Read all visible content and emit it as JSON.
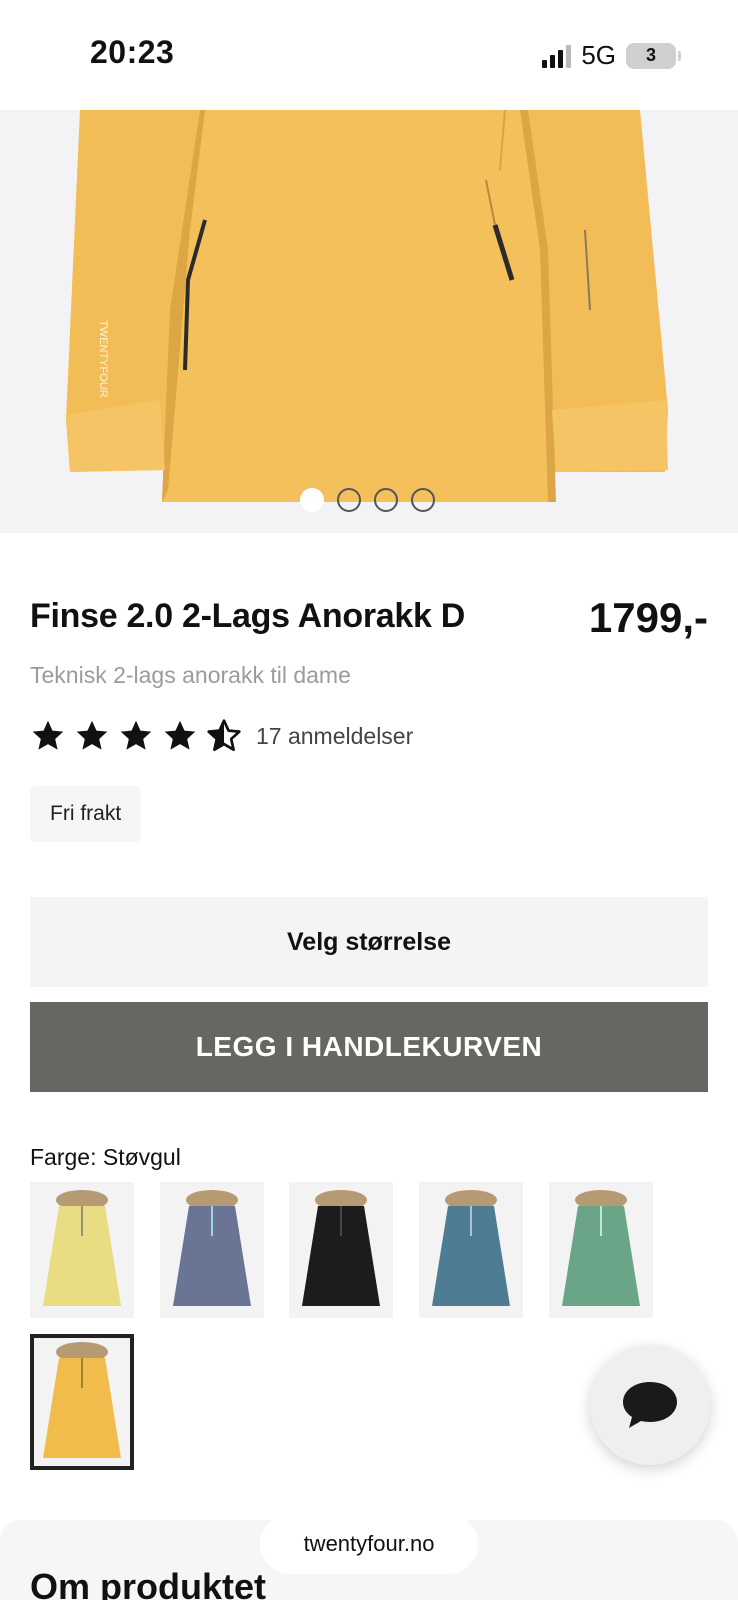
{
  "status_bar": {
    "time": "20:23",
    "network": "5G",
    "battery": "3"
  },
  "product": {
    "title": "Finse 2.0 2-Lags Anorakk D",
    "price": "1799,-",
    "subtitle": "Teknisk 2-lags anorakk til dame",
    "rating": 4.5,
    "reviews": "17 anmeldelser",
    "badge": "Fri frakt"
  },
  "gallery": {
    "image_count": 4,
    "active_index": 0
  },
  "actions": {
    "size_label": "Velg størrelse",
    "cart_label": "LEGG I HANDLEKURVEN"
  },
  "colors": {
    "label": "Farge: Støvgul",
    "swatches": [
      {
        "color": "#e8dd82"
      },
      {
        "color": "#6a7596"
      },
      {
        "color": "#1c1c1c"
      },
      {
        "color": "#4d7c93"
      },
      {
        "color": "#6aa587"
      },
      {
        "color": "#f2bc4c",
        "selected": true
      }
    ]
  },
  "footer": {
    "section_title": "Om produktet",
    "url": "twentyfour.no"
  },
  "icons": {
    "chat": "chat-bubble-icon",
    "star": "star-icon"
  }
}
